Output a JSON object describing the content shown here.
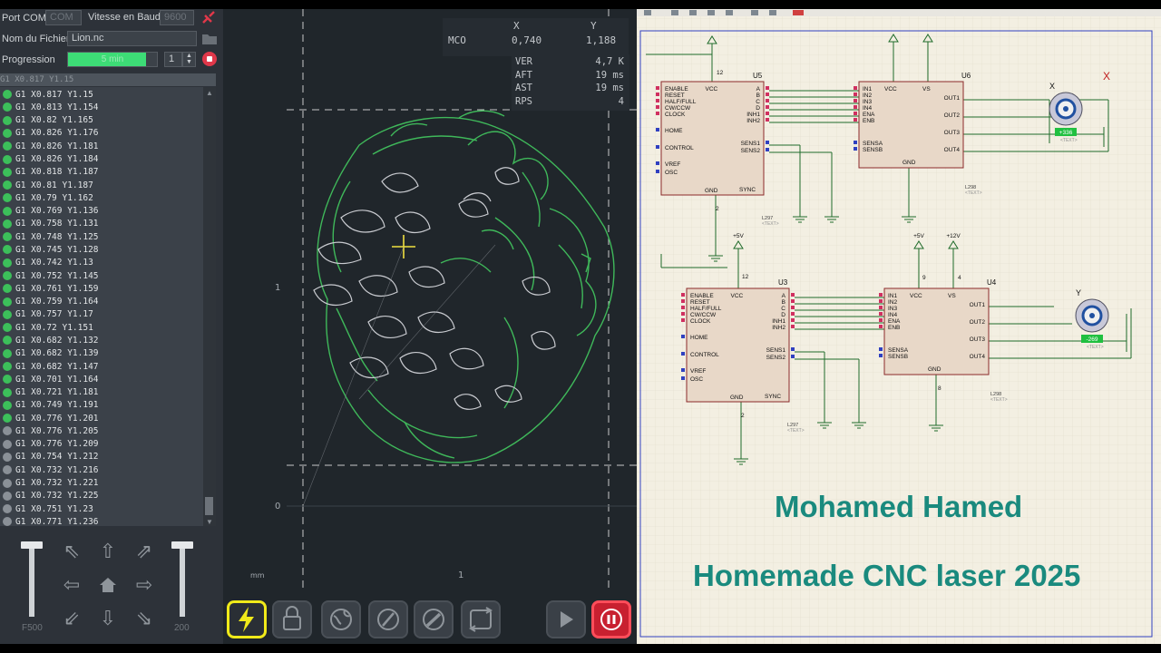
{
  "left_panel": {
    "port_label": "Port COM",
    "port_value": "COM",
    "baud_label": "Vitesse en Baud",
    "baud_value": "9600",
    "file_label": "Nom du Fichier",
    "file_value": "Lion.nc",
    "progress_label": "Progression",
    "progress_text": "5 min",
    "progress_fraction": 0.88,
    "spinner_value": "1",
    "gcode_header": "G1 X0.817 Y1.15",
    "gcode_lines": [
      {
        "text": "G1 X0.817 Y1.15",
        "done": true
      },
      {
        "text": "G1 X0.813 Y1.154",
        "done": true
      },
      {
        "text": "G1 X0.82 Y1.165",
        "done": true
      },
      {
        "text": "G1 X0.826 Y1.176",
        "done": true
      },
      {
        "text": "G1 X0.826 Y1.181",
        "done": true
      },
      {
        "text": "G1 X0.826 Y1.184",
        "done": true
      },
      {
        "text": "G1 X0.818 Y1.187",
        "done": true
      },
      {
        "text": "G1 X0.81 Y1.187",
        "done": true
      },
      {
        "text": "G1 X0.79 Y1.162",
        "done": true
      },
      {
        "text": "G1 X0.769 Y1.136",
        "done": true
      },
      {
        "text": "G1 X0.758 Y1.131",
        "done": true
      },
      {
        "text": "G1 X0.748 Y1.125",
        "done": true
      },
      {
        "text": "G1 X0.745 Y1.128",
        "done": true
      },
      {
        "text": "G1 X0.742 Y1.13",
        "done": true
      },
      {
        "text": "G1 X0.752 Y1.145",
        "done": true
      },
      {
        "text": "G1 X0.761 Y1.159",
        "done": true
      },
      {
        "text": "G1 X0.759 Y1.164",
        "done": true
      },
      {
        "text": "G1 X0.757 Y1.17",
        "done": true
      },
      {
        "text": "G1 X0.72 Y1.151",
        "done": true
      },
      {
        "text": "G1 X0.682 Y1.132",
        "done": true
      },
      {
        "text": "G1 X0.682 Y1.139",
        "done": true
      },
      {
        "text": "G1 X0.682 Y1.147",
        "done": true
      },
      {
        "text": "G1 X0.701 Y1.164",
        "done": true
      },
      {
        "text": "G1 X0.721 Y1.181",
        "done": true
      },
      {
        "text": "G1 X0.749 Y1.191",
        "done": true
      },
      {
        "text": "G1 X0.776 Y1.201",
        "done": true
      },
      {
        "text": "G1 X0.776 Y1.205",
        "done": false
      },
      {
        "text": "G1 X0.776 Y1.209",
        "done": false
      },
      {
        "text": "G1 X0.754 Y1.212",
        "done": false
      },
      {
        "text": "G1 X0.732 Y1.216",
        "done": false
      },
      {
        "text": "G1 X0.732 Y1.221",
        "done": false
      },
      {
        "text": "G1 X0.732 Y1.225",
        "done": false
      },
      {
        "text": "G1 X0.751 Y1.23",
        "done": false
      },
      {
        "text": "G1 X0.771 Y1.236",
        "done": false
      }
    ],
    "feed_label": "F500",
    "power_label": "200"
  },
  "visualizer": {
    "x_header": "X",
    "y_header": "Y",
    "mco_label": "MCO",
    "mco_x": "0,740",
    "mco_y": "1,188",
    "stats": [
      {
        "k": "VER",
        "v": "4,7 K"
      },
      {
        "k": "AFT",
        "v": "19 ms"
      },
      {
        "k": "AST",
        "v": "19 ms"
      },
      {
        "k": "RPS",
        "v": "4"
      }
    ],
    "axis_y_1": "1",
    "axis_y_0": "0",
    "axis_x_1": "1",
    "unit": "mm"
  },
  "schematic": {
    "u5": "U5",
    "u6": "U6",
    "u3": "U3",
    "u4": "U4",
    "motor_x": "X",
    "motor_y": "Y",
    "motor_x_value": "+336",
    "motor_y_value": "-269",
    "x_marker": "X",
    "plus5": "+5V",
    "plus12": "+12V",
    "l297": "L297",
    "l298": "L298",
    "text_tag": "<TEXT>",
    "l297_pins_left": [
      "ENABLE",
      "RESET",
      "HALF/FULL",
      "CW/CCW",
      "CLOCK",
      "HOME",
      "CONTROL",
      "VREF",
      "OSC"
    ],
    "l297_pins_right": [
      "A",
      "B",
      "C",
      "D",
      "INH1",
      "INH2",
      "SENS1",
      "SENS2"
    ],
    "l297_bottom": [
      "GND",
      "SYNC"
    ],
    "l297_top": "VCC",
    "l298_pins_left": [
      "IN1",
      "IN2",
      "IN3",
      "IN4",
      "ENA",
      "ENB",
      "SENSA",
      "SENSB"
    ],
    "l298_pins_right": [
      "OUT1",
      "OUT2",
      "OUT3",
      "OUT4"
    ],
    "l298_top": [
      "VCC",
      "VS"
    ],
    "l298_bottom": "GND",
    "credit_name": "Mohamed Hamed",
    "credit_title": "Homemade CNC laser 2025"
  }
}
